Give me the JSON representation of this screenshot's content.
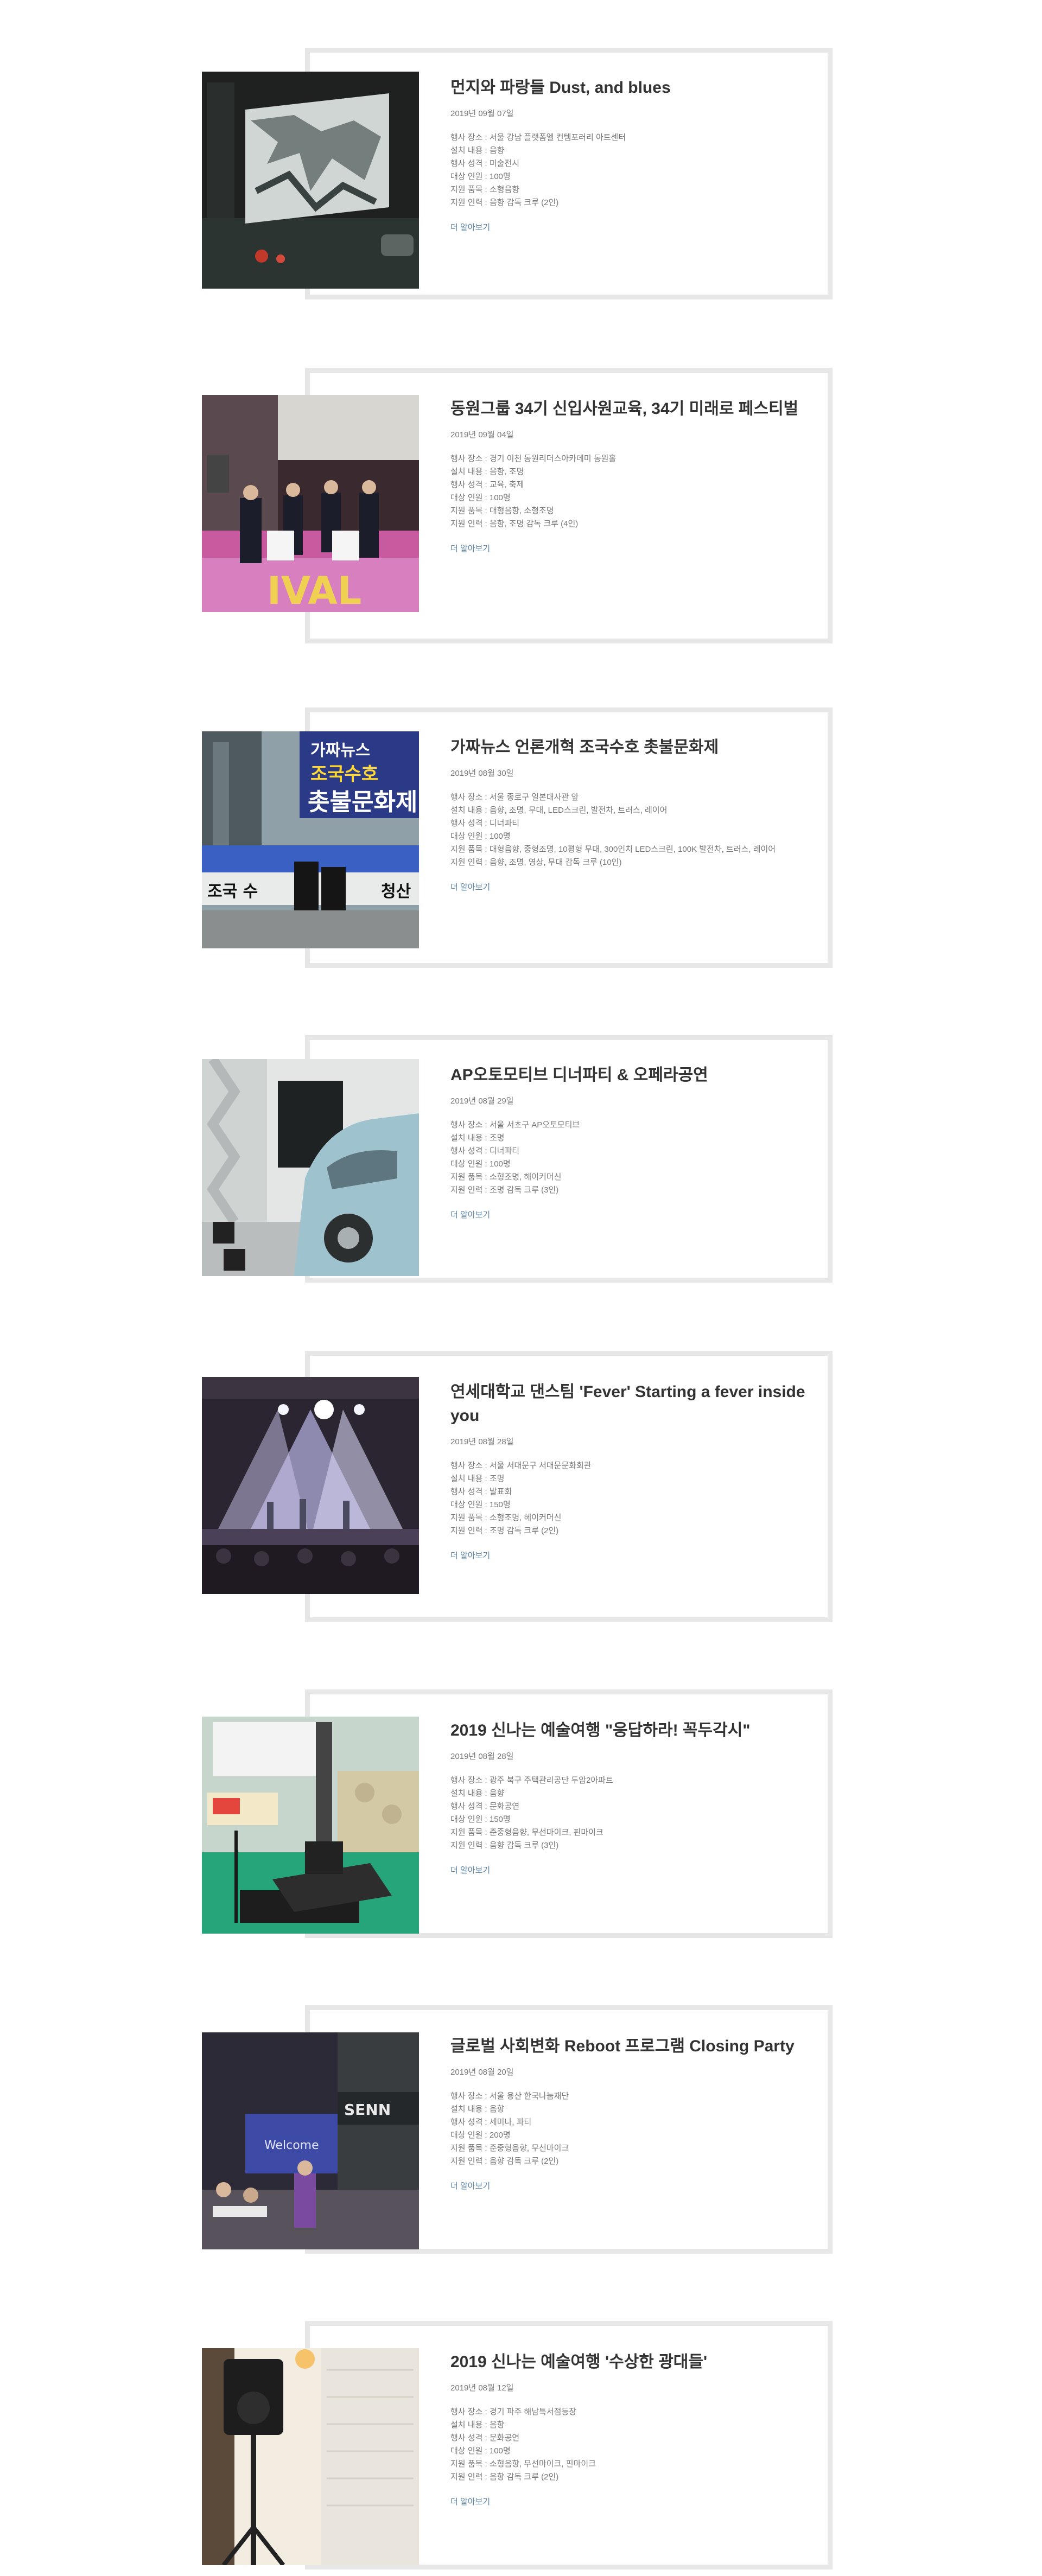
{
  "posts": [
    {
      "title": "먼지와 파랑들 Dust, and blues",
      "date": "2019년 09월 07일",
      "details": [
        "행사 장소 : 서울 강남 플랫폼엘 컨템포러리 아트센터",
        "설치 내용 : 음향",
        "행사 성격 : 미술전시",
        "대상 인원 : 100명",
        "지원 품목 : 소형음향",
        "지원 인력 : 음향 감독 크루 (2인)"
      ],
      "more": "더 알아보기",
      "image": "projection-screen-photo"
    },
    {
      "title": "동원그룹 34기 신입사원교육, 34기 미래로 페스티벌",
      "date": "2019년 09월 04일",
      "details": [
        "행사 장소 : 경기 이천 동원리더스아카데미 동원홀",
        "설치 내용 : 음향, 조명",
        "행사 성격 : 교육, 축제",
        "대상 인원 : 100명",
        "지원 품목 : 대형음향, 소형조명",
        "지원 인력 : 음향, 조명 감독 크루 (4인)"
      ],
      "more": "더 알아보기",
      "image": "stage-ceremony-photo"
    },
    {
      "title": "가짜뉴스 언론개혁 조국수호 촛불문화제",
      "date": "2019년 08월 30일",
      "details": [
        "행사 장소 : 서울 종로구 일본대사관 앞",
        "설치 내용 : 음향, 조명, 무대, LED스크린, 발전차, 트러스, 레이어",
        "행사 성격 : 디너파티",
        "대상 인원 : 100명",
        "지원 품목 : 대형음향, 중형조명, 10평형 무대, 300인치 LED스크린, 100K 발전차, 트러스, 레이어",
        "지원 인력 : 음향, 조명, 영상, 무대 감독 크루 (10인)"
      ],
      "more": "더 알아보기",
      "image": "outdoor-stage-banner-photo"
    },
    {
      "title": "AP오토모티브 디너파티 & 오페라공연",
      "date": "2019년 08월 29일",
      "details": [
        "행사 장소 : 서울 서초구 AP오토모티브",
        "설치 내용 : 조명",
        "행사 성격 : 디너파티",
        "대상 인원 : 100명",
        "지원 품목 : 소형조명, 헤이커머신",
        "지원 인력 : 조명 감독 크루 (3인)"
      ],
      "more": "더 알아보기",
      "image": "car-showroom-photo"
    },
    {
      "title": "연세대학교 댄스팀 'Fever' Starting a fever inside you",
      "date": "2019년 08월 28일",
      "details": [
        "행사 장소 : 서울 서대문구 서대문문화회관",
        "설치 내용 : 조명",
        "행사 성격 : 발표회",
        "대상 인원 : 150명",
        "지원 품목 : 소형조명, 헤이커머신",
        "지원 인력 : 조명 감독 크루 (2인)"
      ],
      "more": "더 알아보기",
      "image": "dance-stage-lights-photo"
    },
    {
      "title": "2019 신나는 예술여행 \"응답하라! 꼭두각시\"",
      "date": "2019년 08월 28일",
      "details": [
        "행사 장소 : 광주 북구 주택관리공단 두암2아파트",
        "설치 내용 : 음향",
        "행사 성격 : 문화공연",
        "대상 인원 : 150명",
        "지원 품목 : 준중형음향, 무선마이크, 핀마이크",
        "지원 인력 : 음향 감독 크루 (3인)"
      ],
      "more": "더 알아보기",
      "image": "mixer-console-photo"
    },
    {
      "title": "글로벌 사회변화 Reboot 프로그램 Closing Party",
      "date": "2019년 08월 20일",
      "details": [
        "행사 장소 : 서울 용산 한국나눔재단",
        "설치 내용 : 음향",
        "행사 성격 : 세미나, 파티",
        "대상 인원 : 200명",
        "지원 품목 : 준중형음향, 무선마이크",
        "지원 인력 : 음향 감독 크루 (2인)"
      ],
      "more": "더 알아보기",
      "image": "closing-party-photo"
    },
    {
      "title": "2019 신나는 예술여행 '수상한 광대들'",
      "date": "2019년 08월 12일",
      "details": [
        "행사 장소 : 경기 파주 해남특서점등장",
        "설치 내용 : 음향",
        "행사 성격 : 문화공연",
        "대상 인원 : 100명",
        "지원 품목 : 소형음향, 무선마이크, 핀마이크",
        "지원 인력 : 음향 감독 크루 (2인)"
      ],
      "more": "더 알아보기",
      "image": "speaker-stand-photo"
    }
  ]
}
